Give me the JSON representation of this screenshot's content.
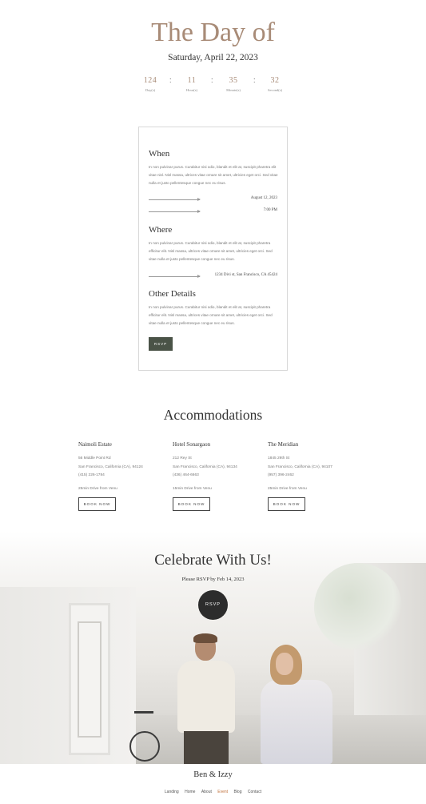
{
  "hero": {
    "title": "The Day of",
    "date": "Saturday, April 22, 2023"
  },
  "countdown": [
    {
      "value": "124",
      "label": "Day(s)"
    },
    {
      "value": "11",
      "label": "Hour(s)"
    },
    {
      "value": "35",
      "label": "Minute(s)"
    },
    {
      "value": "32",
      "label": "Second(s)"
    }
  ],
  "details": {
    "when_title": "When",
    "when_text": "In non pulvinar purus. Curabitur nisi odio, blandit et elit at, suscipit pharetra elit vitae nisl. Nisl massa, ultrices vitae ornare sit amet, ultricies eget orci. Sed vitae nulla et justo pellentesque congue nec eu risus.",
    "when_date": "August 12, 2023",
    "when_time": "7:00 PM",
    "where_title": "Where",
    "where_text": "In non pulvinar purus. Curabitur nisi odio, blandit et elit at, suscipit pharetra efficitur elit. Nisl massa, ultrices vitae ornare sit amet, ultricies eget orci. Sed vitae nulla et justo pellentesque congue nec eu risus.",
    "where_address": "1234 Divi st, San Francisco, CA 45424",
    "other_title": "Other Details",
    "other_text": "In non pulvinar purus. Curabitur nisi odio, blandit et elit at, suscipit pharetra efficitur elit. Nisl massa, ultrices vitae ornare sit amet, ultricies eget orci. Sed vitae nulla et justo pellentesque congue nec eu risus.",
    "rsvp_label": "RSVP"
  },
  "accommodations": {
    "title": "Accommodations",
    "hotels": [
      {
        "name": "Naimoli Estate",
        "street": "56 Middle Point Rd",
        "city": "San Francisco, California (CA), 94124",
        "phone": "(415) 226-1784",
        "drive": "25min Drive from Venu",
        "button": "BOOK NOW"
      },
      {
        "name": "Hotel Sonargaon",
        "street": "212 Rey St",
        "city": "San Francisco, California (CA), 94134",
        "phone": "(436) 464-6663",
        "drive": "15min Drive from Venu",
        "button": "BOOK NOW"
      },
      {
        "name": "The Meridian",
        "street": "1845 29th St",
        "city": "San Francisco, California (CA), 94107",
        "phone": "(957) 396-2462",
        "drive": "25min Drive from Venu",
        "button": "BOOK NOW"
      }
    ]
  },
  "celebrate": {
    "title": "Celebrate With Us!",
    "subtitle": "Please RSVP by Feb 14, 2023",
    "button": "RSVP"
  },
  "footer": {
    "title": "Ben & Izzy",
    "nav": [
      {
        "label": "Landing",
        "active": false
      },
      {
        "label": "Home",
        "active": false
      },
      {
        "label": "About",
        "active": false
      },
      {
        "label": "Event",
        "active": true
      },
      {
        "label": "Blog",
        "active": false
      },
      {
        "label": "Contact",
        "active": false
      }
    ]
  },
  "colors": {
    "accent": "#a88b77",
    "button_dark": "#4a5347",
    "nav_active": "#c0703a"
  }
}
